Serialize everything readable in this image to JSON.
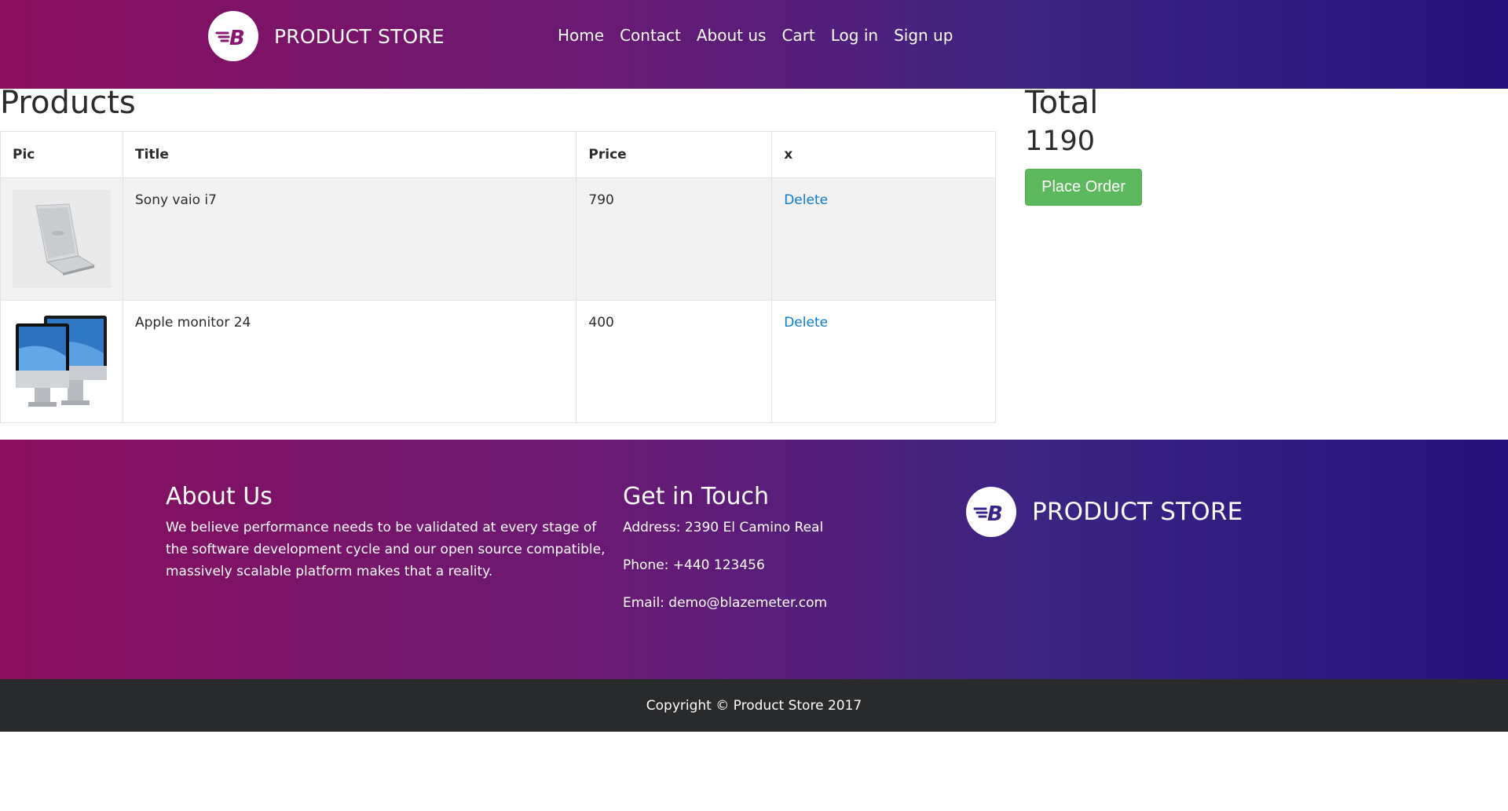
{
  "navbar": {
    "brand_name": "PRODUCT STORE",
    "links": [
      "Home",
      "Contact",
      "About us",
      "Cart",
      "Log in",
      "Sign up"
    ]
  },
  "products": {
    "heading": "Products",
    "columns": [
      "Pic",
      "Title",
      "Price",
      "x"
    ],
    "rows": [
      {
        "title": "Sony vaio i7",
        "price": "790",
        "action": "Delete",
        "pic": "laptop-image"
      },
      {
        "title": "Apple monitor 24",
        "price": "400",
        "action": "Delete",
        "pic": "monitor-image"
      }
    ]
  },
  "summary": {
    "total_label": "Total",
    "total_value": "1190",
    "place_order_label": "Place Order"
  },
  "footer": {
    "about_heading": "About Us",
    "about_text": "We believe performance needs to be validated at every stage of the software development cycle and our open source compatible, massively scalable platform makes that a reality.",
    "touch_heading": "Get in Touch",
    "address": "Address: 2390 El Camino Real",
    "phone": "Phone: +440 123456",
    "email": "Email: demo@blazemeter.com",
    "brand_name": "PRODUCT STORE",
    "copyright": "Copyright © Product Store 2017"
  },
  "colors": {
    "gradient_start": "#8a0e5c",
    "gradient_end": "#25127a",
    "button_green": "#5cb85c",
    "link_blue": "#0a7bd1",
    "copyright_bg": "#282a2c"
  }
}
